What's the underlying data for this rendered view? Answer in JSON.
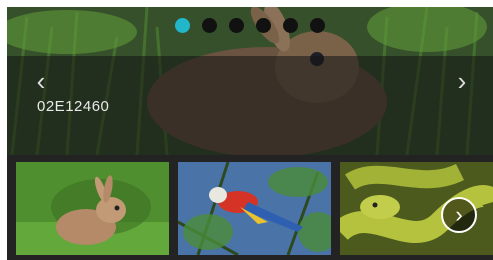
{
  "carousel": {
    "caption": "02E12460",
    "dots_count": 6,
    "active_dot": 1,
    "prev_icon": "chevron-left-icon",
    "next_icon": "chevron-right-icon",
    "prev_glyph": "‹",
    "next_glyph": "›"
  },
  "thumbnails": [
    {
      "name": "rabbit-thumbnail"
    },
    {
      "name": "parrot-thumbnail"
    },
    {
      "name": "snake-thumbnail"
    }
  ],
  "thumb_next": {
    "glyph": "›",
    "icon": "chevron-right-circle-icon"
  },
  "colors": {
    "accent": "#21b6c9",
    "dot_inactive": "#111111",
    "background": "#232323"
  }
}
